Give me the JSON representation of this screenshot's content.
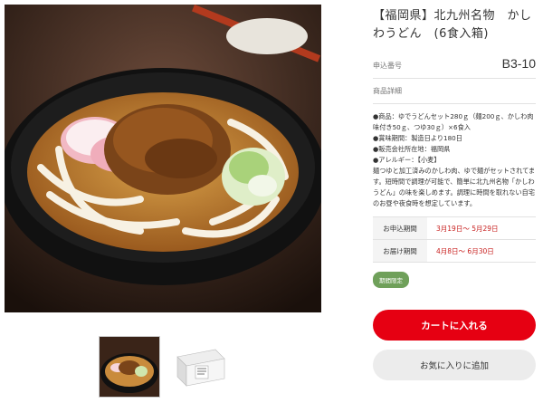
{
  "product": {
    "title": "【福岡県】北九州名物　かしわうどん　(6食入箱)",
    "code_label": "申込番号",
    "code_value": "B3-10",
    "detail_label": "商品詳細",
    "details": [
      "●商品：ゆでうどんセット280ｇ（麺200ｇ、かしわ肉味付き50ｇ、つゆ30ｇ）×6食入",
      "●賞味期間：製造日より180日",
      "●販売会社所在地：福岡県",
      "●アレルギー：【小麦】",
      "麺つゆと加工済みのかしわ肉、ゆで麺がセットされてます。短時間で調理が可能で、簡単に北九州名物「かしわうどん」の味を楽しめます。調理に時間を取れない自宅のお昼や夜食時を想定しています。"
    ]
  },
  "periods": {
    "apply_label": "お申込期間",
    "apply_value": "3月19日～ 5月29日",
    "delivery_label": "お届け期間",
    "delivery_value": "4月8日～ 6月30日"
  },
  "badge": "期間限定",
  "buttons": {
    "cart": "カートに入れる",
    "favorite": "お気に入りに追加"
  },
  "colors": {
    "accent": "#e60012",
    "badge": "#6fa05a",
    "period_text": "#c8201f"
  },
  "images": {
    "main": "udon-bowl-photo",
    "thumbs": [
      "udon-bowl-thumb",
      "package-box-thumb"
    ]
  }
}
